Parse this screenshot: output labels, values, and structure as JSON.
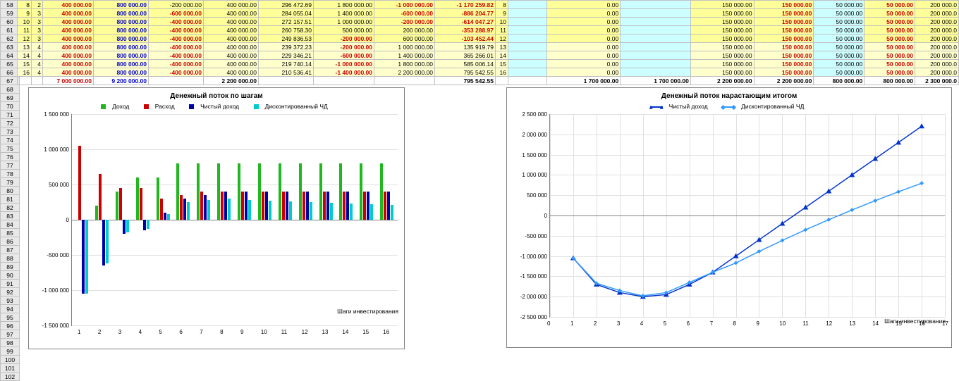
{
  "row_headers": [
    58,
    59,
    60,
    61,
    62,
    63,
    64,
    65,
    66,
    67,
    68,
    69,
    70,
    71,
    72,
    73,
    74,
    75,
    76,
    77,
    78,
    79,
    80,
    81,
    82,
    83,
    84,
    85,
    86,
    87,
    88,
    89,
    90,
    91,
    92,
    93,
    94,
    95,
    96,
    97,
    98,
    99,
    100,
    101,
    102
  ],
  "left_table": {
    "rows": [
      {
        "a": "8",
        "b": "2",
        "c": "400 000.00",
        "cCls": "red",
        "d": "800 000.00",
        "dCls": "blue",
        "e": "-200 000.00",
        "eCls": "",
        "f": "400 000.00",
        "g": "296 472.69",
        "h": "1 800 000.00",
        "i": "-1 000 000.00",
        "iCls": "red",
        "j": "-1 170 259.82",
        "jCls": "red"
      },
      {
        "a": "9",
        "b": "3",
        "c": "400 000.00",
        "cCls": "red",
        "d": "800 000.00",
        "dCls": "blue",
        "e": "-600 000.00",
        "eCls": "red",
        "f": "400 000.00",
        "g": "284 055.04",
        "h": "1 400 000.00",
        "i": "-600 000.00",
        "iCls": "red",
        "j": "-886 204.77",
        "jCls": "red"
      },
      {
        "a": "10",
        "b": "3",
        "c": "400 000.00",
        "cCls": "red",
        "d": "800 000.00",
        "dCls": "blue",
        "e": "-400 000.00",
        "eCls": "red",
        "f": "400 000.00",
        "g": "272 157.51",
        "h": "1 000 000.00",
        "i": "-200 000.00",
        "iCls": "red",
        "j": "-614 047.27",
        "jCls": "red"
      },
      {
        "a": "11",
        "b": "3",
        "c": "400 000.00",
        "cCls": "red",
        "d": "800 000.00",
        "dCls": "blue",
        "e": "-400 000.00",
        "eCls": "red",
        "f": "400 000.00",
        "g": "260 758.30",
        "h": "500 000.00",
        "i": "200 000.00",
        "iCls": "",
        "j": "-353 288.97",
        "jCls": "red"
      },
      {
        "a": "12",
        "b": "3",
        "c": "400 000.00",
        "cCls": "red",
        "d": "800 000.00",
        "dCls": "blue",
        "e": "-400 000.00",
        "eCls": "red",
        "f": "400 000.00",
        "g": "249 836.53",
        "h": "-200 000.00",
        "hCls": "red",
        "i": "600 000.00",
        "iCls": "",
        "j": "-103 452.44",
        "jCls": "red"
      },
      {
        "a": "13",
        "b": "4",
        "c": "400 000.00",
        "cCls": "red",
        "d": "800 000.00",
        "dCls": "blue",
        "e": "-400 000.00",
        "eCls": "red",
        "f": "400 000.00",
        "g": "239 372.23",
        "h": "-200 000.00",
        "hCls": "red",
        "i": "1 000 000.00",
        "iCls": "",
        "j": "135 919.79",
        "jCls": ""
      },
      {
        "a": "14",
        "b": "4",
        "c": "400 000.00",
        "cCls": "red",
        "d": "800 000.00",
        "dCls": "blue",
        "e": "-400 000.00",
        "eCls": "red",
        "f": "400 000.00",
        "g": "229 346.21",
        "h": "-600 000.00",
        "hCls": "red",
        "i": "1 400 000.00",
        "iCls": "",
        "j": "365 266.01",
        "jCls": ""
      },
      {
        "a": "15",
        "b": "4",
        "c": "400 000.00",
        "cCls": "red",
        "d": "800 000.00",
        "dCls": "blue",
        "e": "-400 000.00",
        "eCls": "red",
        "f": "400 000.00",
        "g": "219 740.14",
        "h": "-1 000 000.00",
        "hCls": "red",
        "i": "1 800 000.00",
        "iCls": "",
        "j": "585 006.14",
        "jCls": ""
      },
      {
        "a": "16",
        "b": "4",
        "c": "400 000.00",
        "cCls": "red",
        "d": "800 000.00",
        "dCls": "blue",
        "e": "-400 000.00",
        "eCls": "red",
        "f": "400 000.00",
        "g": "210 536.41",
        "h": "-1 400 000.00",
        "hCls": "red",
        "i": "2 200 000.00",
        "iCls": "",
        "j": "795 542.55",
        "jCls": ""
      }
    ],
    "totals": {
      "c": "7 000 000.00",
      "cCls": "red",
      "d": "9 200 000.00",
      "dCls": "blue",
      "f": "2 200 000.00",
      "j": "795 542.55"
    }
  },
  "right_table": {
    "rows": [
      {
        "a": "8",
        "c": "0.00",
        "e": "150 000.00",
        "f": "150 000.00",
        "fCls": "red",
        "g": "50 000.00",
        "h": "50 000.00",
        "hCls": "red",
        "i": "200 000.0"
      },
      {
        "a": "9",
        "c": "0.00",
        "e": "150 000.00",
        "f": "150 000.00",
        "fCls": "red",
        "g": "50 000.00",
        "h": "50 000.00",
        "hCls": "red",
        "i": "200 000.0"
      },
      {
        "a": "10",
        "c": "0.00",
        "e": "150 000.00",
        "f": "150 000.00",
        "fCls": "red",
        "g": "50 000.00",
        "h": "50 000.00",
        "hCls": "red",
        "i": "200 000.0"
      },
      {
        "a": "11",
        "c": "0.00",
        "e": "150 000.00",
        "f": "150 000.00",
        "fCls": "red",
        "g": "50 000.00",
        "h": "50 000.00",
        "hCls": "red",
        "i": "200 000.0"
      },
      {
        "a": "12",
        "c": "0.00",
        "e": "150 000.00",
        "f": "150 000.00",
        "fCls": "red",
        "g": "50 000.00",
        "h": "50 000.00",
        "hCls": "red",
        "i": "200 000.0"
      },
      {
        "a": "13",
        "c": "0.00",
        "e": "150 000.00",
        "f": "150 000.00",
        "fCls": "red",
        "g": "50 000.00",
        "h": "50 000.00",
        "hCls": "red",
        "i": "200 000.0"
      },
      {
        "a": "14",
        "c": "0.00",
        "e": "150 000.00",
        "f": "150 000.00",
        "fCls": "red",
        "g": "50 000.00",
        "h": "50 000.00",
        "hCls": "red",
        "i": "200 000.0"
      },
      {
        "a": "15",
        "c": "0.00",
        "e": "150 000.00",
        "f": "150 000.00",
        "fCls": "red",
        "g": "50 000.00",
        "h": "50 000.00",
        "hCls": "red",
        "i": "200 000.0"
      },
      {
        "a": "16",
        "c": "0.00",
        "e": "150 000.00",
        "f": "150 000.00",
        "fCls": "red",
        "g": "50 000.00",
        "h": "50 000.00",
        "hCls": "red",
        "i": "200 000.0"
      }
    ],
    "totals": {
      "c": "1 700 000.00",
      "d": "1 700 000.00",
      "e": "2 200 000.00",
      "f": "2 200 000.00",
      "g": "800 000.00",
      "h": "800 000.00",
      "i": "2 300 000.0"
    }
  },
  "chart_data": [
    {
      "type": "bar",
      "title": "Денежный поток по шагам",
      "xlabel": "Шаги инвестирования",
      "ylabel": "",
      "categories": [
        1,
        2,
        3,
        4,
        5,
        6,
        7,
        8,
        9,
        10,
        11,
        12,
        13,
        14,
        15,
        16
      ],
      "ylim": [
        -1500000,
        1500000
      ],
      "yticks": [
        -1500000,
        -1000000,
        -500000,
        0,
        500000,
        1000000,
        1500000
      ],
      "series": [
        {
          "name": "Доход",
          "color": "#1fb81f",
          "values": [
            0,
            200000,
            400000,
            600000,
            600000,
            800000,
            800000,
            800000,
            800000,
            800000,
            800000,
            800000,
            800000,
            800000,
            800000,
            800000
          ]
        },
        {
          "name": "Расход",
          "color": "#cc0000",
          "values": [
            1050000,
            650000,
            450000,
            450000,
            300000,
            350000,
            400000,
            400000,
            400000,
            400000,
            400000,
            400000,
            400000,
            400000,
            400000,
            400000
          ]
        },
        {
          "name": "Чистый доход",
          "color": "#0000aa",
          "values": [
            -1050000,
            -650000,
            -200000,
            -150000,
            100000,
            300000,
            350000,
            400000,
            400000,
            400000,
            400000,
            400000,
            400000,
            400000,
            400000,
            400000
          ]
        },
        {
          "name": "Дисконтированный ЧД",
          "color": "#00cccc",
          "values": [
            -1050000,
            -620000,
            -180000,
            -130000,
            85000,
            250000,
            280000,
            296000,
            284000,
            272000,
            261000,
            250000,
            239000,
            229000,
            220000,
            211000
          ]
        }
      ],
      "legend": [
        "Доход",
        "Расход",
        "Чистый доход",
        "Дисконтированный ЧД"
      ]
    },
    {
      "type": "line",
      "title": "Денежный поток нарастающим итогом",
      "xlabel": "Шаги инвестирования",
      "ylabel": "",
      "x": [
        1,
        2,
        3,
        4,
        5,
        6,
        7,
        8,
        9,
        10,
        11,
        12,
        13,
        14,
        15,
        16
      ],
      "xlim": [
        0,
        17
      ],
      "xticks": [
        0,
        1,
        2,
        3,
        4,
        5,
        6,
        7,
        8,
        9,
        10,
        11,
        12,
        13,
        14,
        15,
        16,
        17
      ],
      "ylim": [
        -2500000,
        2500000
      ],
      "yticks": [
        -2500000,
        -2000000,
        -1500000,
        -1000000,
        -500000,
        0,
        500000,
        1000000,
        1500000,
        2000000,
        2500000
      ],
      "series": [
        {
          "name": "Чистый доход",
          "color": "#0033cc",
          "marker": "tri",
          "values": [
            -1050000,
            -1700000,
            -1900000,
            -2000000,
            -1950000,
            -1700000,
            -1400000,
            -1000000,
            -600000,
            -200000,
            200000,
            600000,
            1000000,
            1400000,
            1800000,
            2200000
          ]
        },
        {
          "name": "Дисконтированный ЧД",
          "color": "#3399ff",
          "marker": "dia",
          "values": [
            -1050000,
            -1670000,
            -1850000,
            -1980000,
            -1900000,
            -1650000,
            -1400000,
            -1170000,
            -886000,
            -614000,
            -353000,
            -103000,
            136000,
            365000,
            585000,
            796000
          ]
        }
      ],
      "legend": [
        "Чистый доход",
        "Дисконтированный ЧД"
      ]
    }
  ],
  "ytick_labels_bar": [
    "-1 500 000",
    "-1 000 000",
    "-500 000",
    "0",
    "500 000",
    "1 000 000",
    "1 500 000"
  ],
  "ytick_labels_line": [
    "-2 500 000",
    "-2 000 000",
    "-1 500 000",
    "-1 000 000",
    "-500 000",
    "0",
    "500 000",
    "1 000 000",
    "1 500 000",
    "2 000 000",
    "2 500 000"
  ]
}
